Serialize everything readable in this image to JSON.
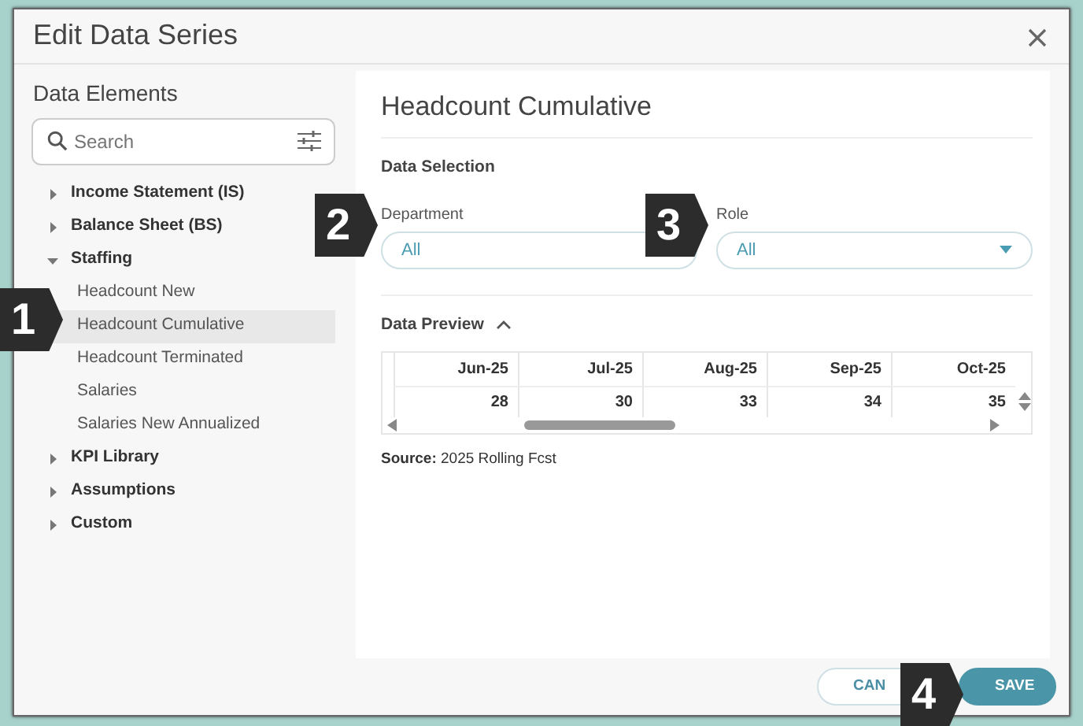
{
  "dialog": {
    "title": "Edit Data Series"
  },
  "sidebar": {
    "heading": "Data Elements",
    "search": {
      "placeholder": "Search"
    },
    "tree": [
      {
        "label": "Income Statement (IS)",
        "expanded": false
      },
      {
        "label": "Balance Sheet (BS)",
        "expanded": false
      },
      {
        "label": "Staffing",
        "expanded": true,
        "children": [
          {
            "label": "Headcount New",
            "selected": false
          },
          {
            "label": "Headcount Cumulative",
            "selected": true
          },
          {
            "label": "Headcount Terminated",
            "selected": false
          },
          {
            "label": "Salaries",
            "selected": false
          },
          {
            "label": "Salaries New Annualized",
            "selected": false
          }
        ]
      },
      {
        "label": "KPI Library",
        "expanded": false
      },
      {
        "label": "Assumptions",
        "expanded": false
      },
      {
        "label": "Custom",
        "expanded": false
      }
    ]
  },
  "panel": {
    "title": "Headcount Cumulative",
    "section": "Data Selection",
    "filters": [
      {
        "label": "Department",
        "value": "All",
        "kind": "text"
      },
      {
        "label": "Role",
        "value": "All",
        "kind": "dropdown"
      }
    ],
    "preview": {
      "heading": "Data Preview",
      "expanded": true,
      "columns": [
        "Jun-25",
        "Jul-25",
        "Aug-25",
        "Sep-25",
        "Oct-25"
      ],
      "rows": [
        [
          "28",
          "30",
          "33",
          "34",
          "35"
        ]
      ]
    },
    "source_label": "Source:",
    "source": "2025 Rolling Fcst"
  },
  "footer": {
    "buttons": [
      {
        "label": "CAN",
        "kind": "secondary"
      },
      {
        "label": "SAVE",
        "kind": "primary"
      }
    ]
  },
  "callouts": [
    "1",
    "2",
    "3",
    "4"
  ]
}
